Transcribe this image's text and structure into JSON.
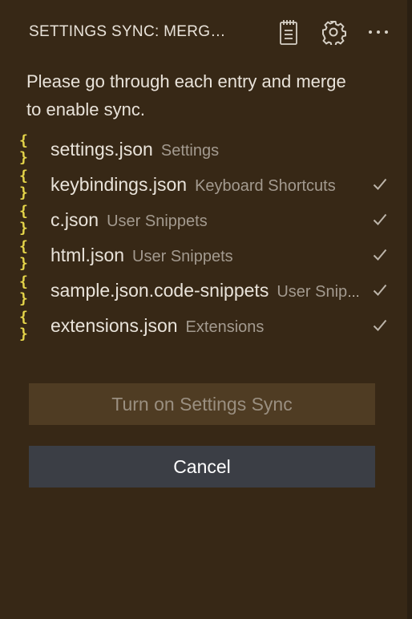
{
  "header": {
    "title": "SETTINGS SYNC: MERGES",
    "actions": [
      {
        "icon": "notebook-icon"
      },
      {
        "icon": "gear-icon"
      },
      {
        "icon": "ellipsis-icon"
      }
    ]
  },
  "description": "Please go through each entry and merge to enable sync.",
  "entries": [
    {
      "icon": "json-braces-icon",
      "glyph": "{ }",
      "file": "settings.json",
      "desc": "Settings",
      "merged": false
    },
    {
      "icon": "json-braces-icon",
      "glyph": "{ }",
      "file": "keybindings.json",
      "desc": "Keyboard Shortcuts",
      "merged": true
    },
    {
      "icon": "json-braces-icon",
      "glyph": "{ }",
      "file": "c.json",
      "desc": "User Snippets",
      "merged": true
    },
    {
      "icon": "json-braces-icon",
      "glyph": "{ }",
      "file": "html.json",
      "desc": "User Snippets",
      "merged": true
    },
    {
      "icon": "json-braces-icon",
      "glyph": "{ }",
      "file": "sample.json.code-snippets",
      "desc": "User Snippets",
      "merged": true
    },
    {
      "icon": "json-braces-icon",
      "glyph": "{ }",
      "file": "extensions.json",
      "desc": "Extensions",
      "merged": true
    }
  ],
  "buttons": {
    "turn_on": "Turn on Settings Sync",
    "cancel": "Cancel"
  },
  "colors": {
    "background": "#372816",
    "json_icon": "#e6d64a",
    "primary_button_bg": "#4f3c23",
    "secondary_button_bg": "#3b3e45"
  }
}
